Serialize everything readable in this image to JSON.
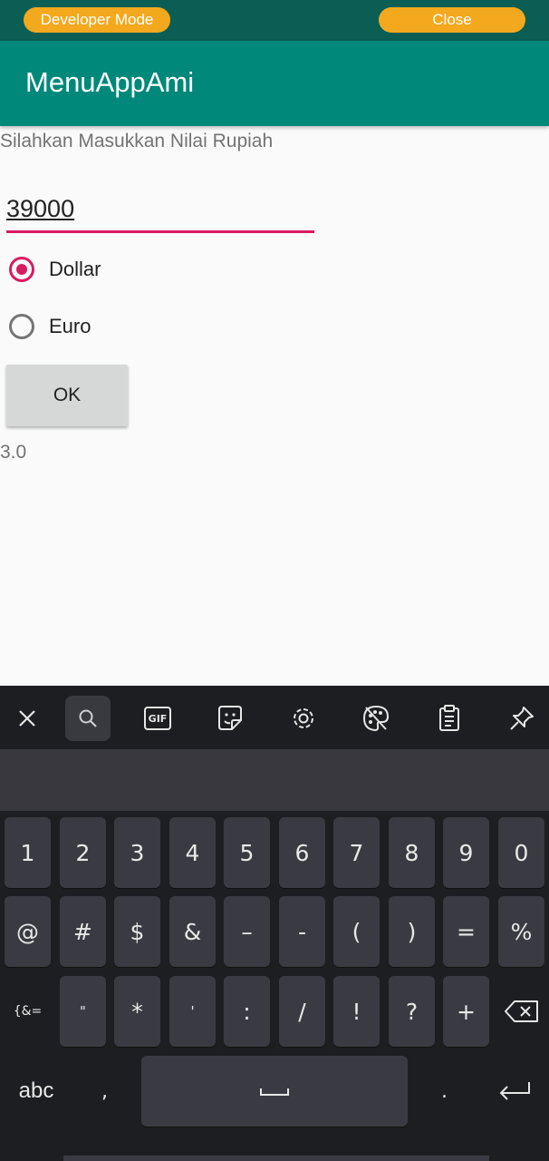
{
  "devbar": {
    "developer_mode": "Developer Mode",
    "close": "Close"
  },
  "appbar": {
    "title": "MenuAppAmi"
  },
  "form": {
    "prompt": "Silahkan Masukkan Nilai Rupiah",
    "amount_value": "39000",
    "options": [
      {
        "label": "Dollar",
        "selected": true
      },
      {
        "label": "Euro",
        "selected": false
      }
    ],
    "ok_label": "OK",
    "result": "3.0"
  },
  "colors": {
    "accent": "#d81b60",
    "primary": "#00887a",
    "primary_dark": "#0a5e54",
    "dev_pill": "#f4a81d"
  },
  "keyboard": {
    "toolbar_icons": [
      "close-icon",
      "search-icon",
      "gif-icon",
      "sticker-icon",
      "settings-icon",
      "palette-icon",
      "clipboard-icon",
      "pin-icon"
    ],
    "gif_label": "GIF",
    "row1": [
      "1",
      "2",
      "3",
      "4",
      "5",
      "6",
      "7",
      "8",
      "9",
      "0"
    ],
    "row2": [
      "@",
      "#",
      "$",
      "&",
      "–",
      "-",
      "(",
      ")",
      "=",
      "%"
    ],
    "row3_mode": "{&=",
    "row3": [
      "\"",
      "*",
      "'",
      ":",
      "/",
      "!",
      "?",
      "+"
    ],
    "abc": "abc",
    "comma": ",",
    "period": "."
  }
}
